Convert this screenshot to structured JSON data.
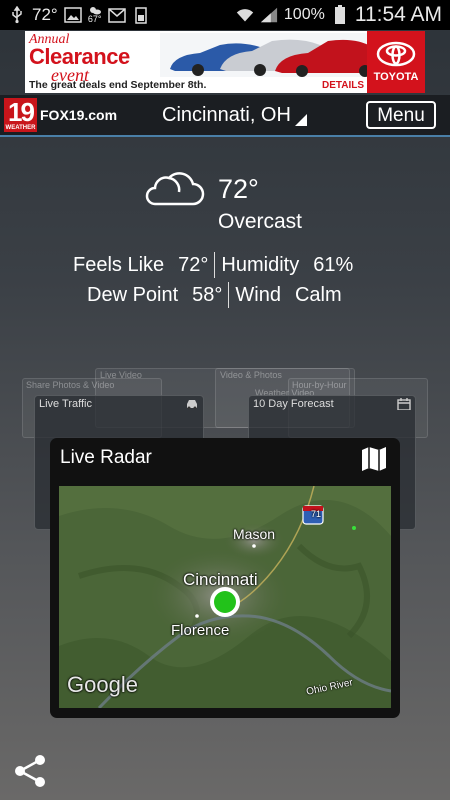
{
  "status_bar": {
    "temp": "72°",
    "weather_small_temp": "67°",
    "battery_pct": "100%",
    "time": "11:54 AM",
    "icons": [
      "usb-icon",
      "image-icon",
      "weather-icon",
      "gmail-icon",
      "storage-icon",
      "wifi-icon",
      "signal-icon",
      "battery-icon"
    ]
  },
  "ad": {
    "line1": "Annual",
    "line2": "Clearance",
    "line3": "event",
    "tagline": "The great deals end September 8th.",
    "details": "DETAILS >",
    "brand": "TOYOTA",
    "brand_color": "#d3121c"
  },
  "header": {
    "logo_number": "19",
    "logo_sub": "WEATHER",
    "logo_text": "FOX19.com",
    "city": "Cincinnati, OH",
    "menu_label": "Menu",
    "accent": "#4a7fa8"
  },
  "conditions": {
    "temp": "72°",
    "description": "Overcast",
    "feels_like_label": "Feels Like",
    "feels_like_value": "72°",
    "humidity_label": "Humidity",
    "humidity_value": "61%",
    "dew_point_label": "Dew Point",
    "dew_point_value": "58°",
    "wind_label": "Wind",
    "wind_value": "Calm"
  },
  "background_cards": {
    "live_video": "Live Video",
    "share": "Share Photos & Video",
    "video_photos": "Video & Photos",
    "hour_by_hour": "Hour-by-Hour",
    "weather_video": "Weather Video",
    "live_traffic": "Live Traffic",
    "ten_day": "10 Day Forecast"
  },
  "radar": {
    "title": "Live Radar",
    "labels": {
      "mason": "Mason",
      "cincinnati": "Cincinnati",
      "florence": "Florence",
      "google": "Google",
      "ohio_river": "Ohio River",
      "interstate": "71"
    },
    "marker_color": "#22c21a"
  }
}
